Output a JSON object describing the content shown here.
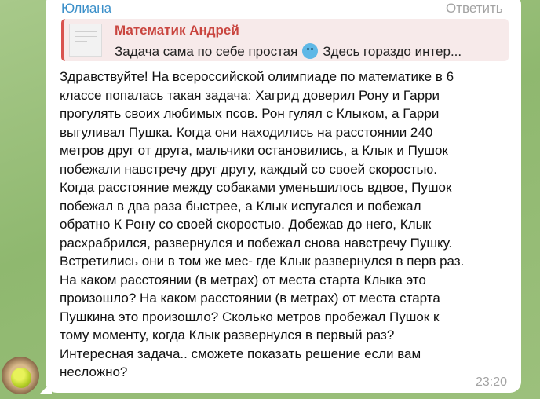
{
  "message": {
    "sender": "Юлиана",
    "reply_label": "Ответить",
    "quote": {
      "author": "Математик Андрей",
      "text_before_emoji": "Задача сама по себе простая",
      "emoji": "smiling-face-emoji",
      "text_after_emoji": "Здесь гораздо интер..."
    },
    "body_lines": [
      "Здравствуйте! На всероссийской олимпиаде по математике в 6",
      "классе попалась такая задача: Хагрид доверил Рону и Гарри",
      "прогулять своих любимых псов. Рон гулял с Клыком, а Гарри",
      "выгуливал Пушка. Когда они находились на расстоянии 240",
      "метров друг от друга, мальчики остановились, а Клык и Пушок",
      "побежали навстречу друг другу, каждый со своей скоростью.",
      "Когда расстояние между собаками уменьшилось вдвое, Пушок",
      "побежал в два раза быстрее, а Клык испугался и побежал",
      "обратно К Рону со своей скоростью. Добежав до него, Клык",
      "расхрабрился, развернулся и побежал снова навстречу Пушку.",
      "Встретились они в том же мес- где Клык развернулся в перв раз.",
      "На каком расстоянии (в метрах) от места старта Клыка это",
      "произошло? На каком расстоянии (в метрах) от места старта",
      "Пушкина это произошло? Сколько метров пробежал Пушок к",
      "тому моменту, когда Клык развернулся в первый раз?",
      "Интересная задача.. сможете показать решение если вам",
      "несложно?"
    ],
    "time": "23:20"
  },
  "colors": {
    "sender_name": "#3a8fc9",
    "quote_accent": "#d9534f",
    "quote_background": "#f7eaea",
    "muted_text": "#a3a3a3",
    "bubble": "#ffffff",
    "chat_background": "#9dbf7e"
  }
}
